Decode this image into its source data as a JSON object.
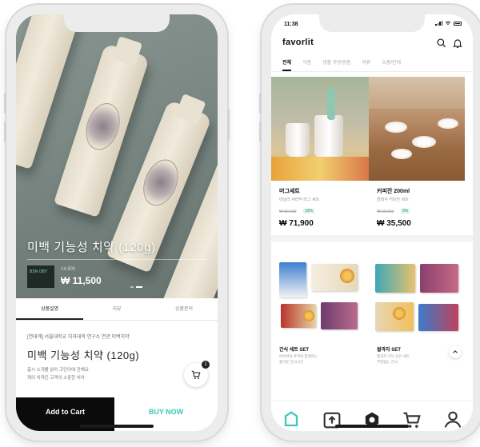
{
  "detail": {
    "hero_title": "미백 기능성 치약 (120g)",
    "thumb_text": "BSN OBY",
    "price_sub": "14,900",
    "price": "₩ 11,500",
    "tabs": [
      "상품설명",
      "리뷰",
      "상품문의"
    ],
    "desc_small": "[연대계] 서울대학교 치과대학 연구소 연관 미백치약",
    "desc_title": "미백 기능성 치약 (120g)",
    "desc_lines": [
      "출시 소개를 읽어 고민이에 관해요",
      "제의 치약은 고객의 소중한 치아"
    ],
    "cart_count": "1",
    "add_to_cart": "Add to Cart",
    "buy_now": "BUY NOW"
  },
  "home": {
    "status_time": "11:38",
    "logo": "favorlit",
    "categories": [
      "전체",
      "식품",
      "생활·주방용품",
      "의류",
      "소품/인테"
    ],
    "products": [
      {
        "name": "머그세트",
        "desc": "바닐라 세라믹 머그 세트",
        "old_price": "₩ 89,000",
        "discount": "19%",
        "price": "₩ 71,900"
      },
      {
        "name": "커피잔 200ml",
        "desc": "클래식 커피잔 세트",
        "old_price": "₩ 39,000",
        "discount": "9%",
        "price": "₩ 35,500"
      }
    ],
    "sets": [
      {
        "name": "간식 세트 SET",
        "desc": [
          "바삭바삭 쿠키와 함께하는",
          "즐거운 간식시간"
        ]
      },
      {
        "name": "쌀과자 SET",
        "desc": [
          "쌀과자 가득 담은 세트",
          "부담없는 간식"
        ]
      }
    ]
  },
  "colors": {
    "accent": "#3cc9b8",
    "dark": "#0b0b0b",
    "discount": "#2e9c62"
  }
}
